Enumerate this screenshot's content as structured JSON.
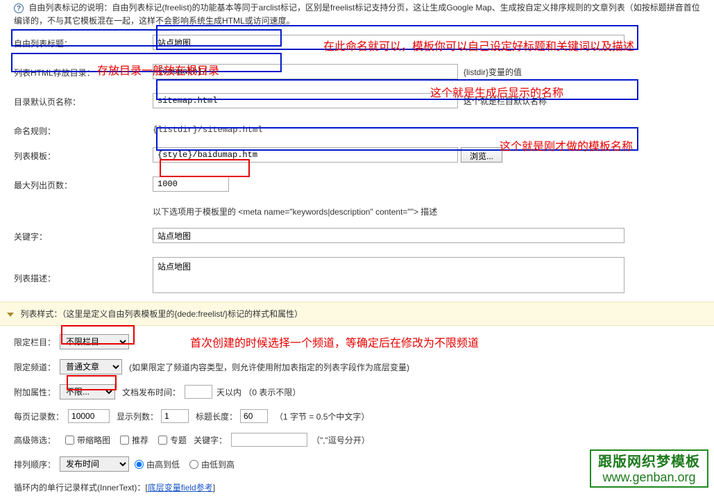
{
  "intro": "自由列表标记的说明：自由列表标记(freelist)的功能基本等同于arclist标记，区别是freelist标记支持分页，这让生成Google Map、生成按自定义排序规则的文章列表（如按标题拼音首位编译的，不与其它模板混在一起，这样不会影响系统生成HTML或访问速度。",
  "labels": {
    "title": "自由列表标题：",
    "dir": "列表HTML存放目录：",
    "defaultPage": "目录默认页名称：",
    "namingRule": "命名规则：",
    "template": "列表模板：",
    "maxPages": "最大列出页数：",
    "metaNote": "以下选项用于模板里的 <meta name=\"keywords|description\" content=\"\"> 描述",
    "keywords": "关键字：",
    "description": "列表描述："
  },
  "values": {
    "title": "站点地图",
    "dir": "{cmspath}/",
    "dirHint": "{listdir}变量的值",
    "defaultPage": "sitemap.html",
    "defaultPageHint": "这个就是栏目默认名称",
    "namingRule": "{listdir}/sitemap.html",
    "template": "{style}/baidumap.htm",
    "browseBtn": "浏览...",
    "maxPages": "1000",
    "keywords": "站点地图",
    "description": "站点地图"
  },
  "annotations": {
    "dirNote": "存放目录一般放在根目录",
    "titleNote": "在此命名就可以，模板你可以自己设定好标题和关键词以及描述",
    "defaultPageNote": "这个就是生成后显示的名称",
    "templateNote": "这个就是刚才做的模板名称",
    "channelNote": "首次创建的时候选择一个频道，等确定后在修改为不限频道"
  },
  "section2Title": "列表样式：（这里是定义自由列表模板里的{dede:freelist/}标记的样式和属性）",
  "lower": {
    "limitColumn": {
      "label": "限定栏目：",
      "selected": "不限栏目...",
      "options": [
        "不限栏目..."
      ]
    },
    "limitChannel": {
      "label": "限定频道：",
      "selected": "普通文章",
      "options": [
        "普通文章"
      ],
      "hint": "(如果限定了频道内容类型，则允许使用附加表指定的列表字段作为底层变量)"
    },
    "attr": {
      "label": "附加属性：",
      "selected": "不限...",
      "options": [
        "不限..."
      ],
      "pubTimeLabel": "文档发布时间：",
      "pubTimeVal": "",
      "pubTimeSuffix": "天以内 （0 表示不限）"
    },
    "perPage": {
      "label": "每页记录数：",
      "val": "10000",
      "colsLabel": "显示列数：",
      "colsVal": "1",
      "titleLenLabel": "标题长度：",
      "titleLenVal": "60",
      "titleLenSuffix": "（1 字节 = 0.5个中文字）"
    },
    "advFilter": {
      "label": "高级筛选：",
      "thumb": "带缩略图",
      "rec": "推荐",
      "topic": "专题",
      "kwLabel": "关键字：",
      "kwVal": "",
      "kwSuffix": "（\",\"逗号分开）"
    },
    "sort": {
      "label": "排列顺序：",
      "selected": "发布时间",
      "options": [
        "发布时间"
      ],
      "desc": "由高到低",
      "asc": "由低到高"
    },
    "innerText": {
      "label": "循环内的单行记录样式(InnerText)：[",
      "link": "底层变量field参考",
      "close": "]"
    }
  },
  "watermark": {
    "line1": "跟版网织梦模板",
    "line2": "www.genban.org"
  }
}
